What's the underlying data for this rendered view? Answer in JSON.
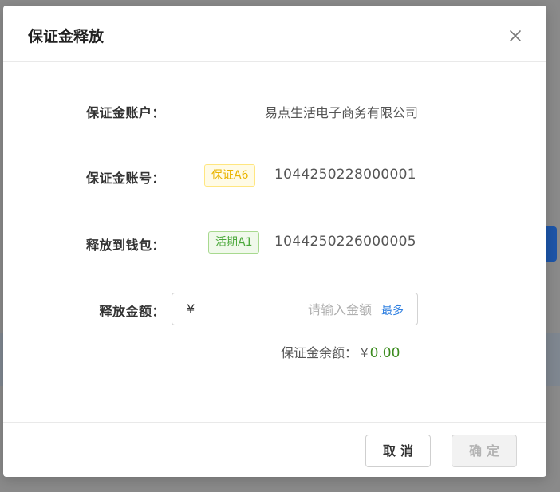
{
  "dialog": {
    "title": "保证金释放",
    "close_icon": "close-icon"
  },
  "form": {
    "account_label": "保证金账户：",
    "account_value": "易点生活电子商务有限公司",
    "deposit_no_label": "保证金账号：",
    "deposit_tag": "保证A6",
    "deposit_no": "1044250228000001",
    "wallet_label": "释放到钱包：",
    "wallet_tag": "活期A1",
    "wallet_no": "1044250226000005",
    "amount_label": "释放金额：",
    "amount_prefix": "¥",
    "amount_value": "",
    "amount_placeholder": "请输入金额",
    "max_label": "最多",
    "balance_label": "保证金余额：",
    "balance_currency": "¥",
    "balance_value": "0.00"
  },
  "footer": {
    "cancel_label": "取消",
    "ok_label": "确定"
  },
  "colors": {
    "deposit_tag": "#e9b400",
    "wallet_tag": "#4aa83a",
    "balance_value": "#3b8b1e",
    "max_link": "#2f7fe0"
  }
}
